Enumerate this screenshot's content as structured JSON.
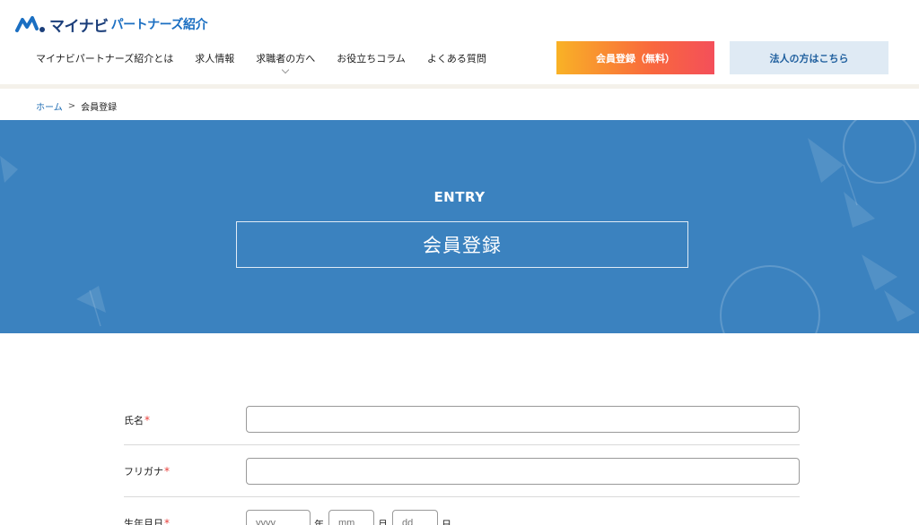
{
  "header": {
    "logo_main": "マイナビ",
    "logo_sub": "パートナーズ紹介",
    "nav": [
      {
        "label": "マイナビパートナーズ紹介とは"
      },
      {
        "label": "求人情報"
      },
      {
        "label": "求職者の方へ"
      },
      {
        "label": "お役立ちコラム"
      },
      {
        "label": "よくある質問"
      }
    ],
    "register_button": "会員登録（無料）",
    "corporate_button": "法人の方はこちら"
  },
  "breadcrumb": {
    "home": "ホーム",
    "separator": ">",
    "current": "会員登録"
  },
  "hero": {
    "subtitle": "ENTRY",
    "title": "会員登録"
  },
  "form": {
    "required_mark": "*",
    "name_label": "氏名",
    "furigana_label": "フリガナ",
    "birthdate_label": "生年月日",
    "year_placeholder": "yyyy",
    "year_unit": "年",
    "month_placeholder": "mm",
    "month_unit": "月",
    "day_placeholder": "dd",
    "day_unit": "日"
  },
  "colors": {
    "brand_blue": "#3b82bf",
    "logo_navy": "#1b3e7a",
    "required_red": "#e8413c",
    "register_gradient_start": "#f9b226",
    "register_gradient_end": "#f44f5a",
    "corporate_bg": "#dfeaf4"
  }
}
